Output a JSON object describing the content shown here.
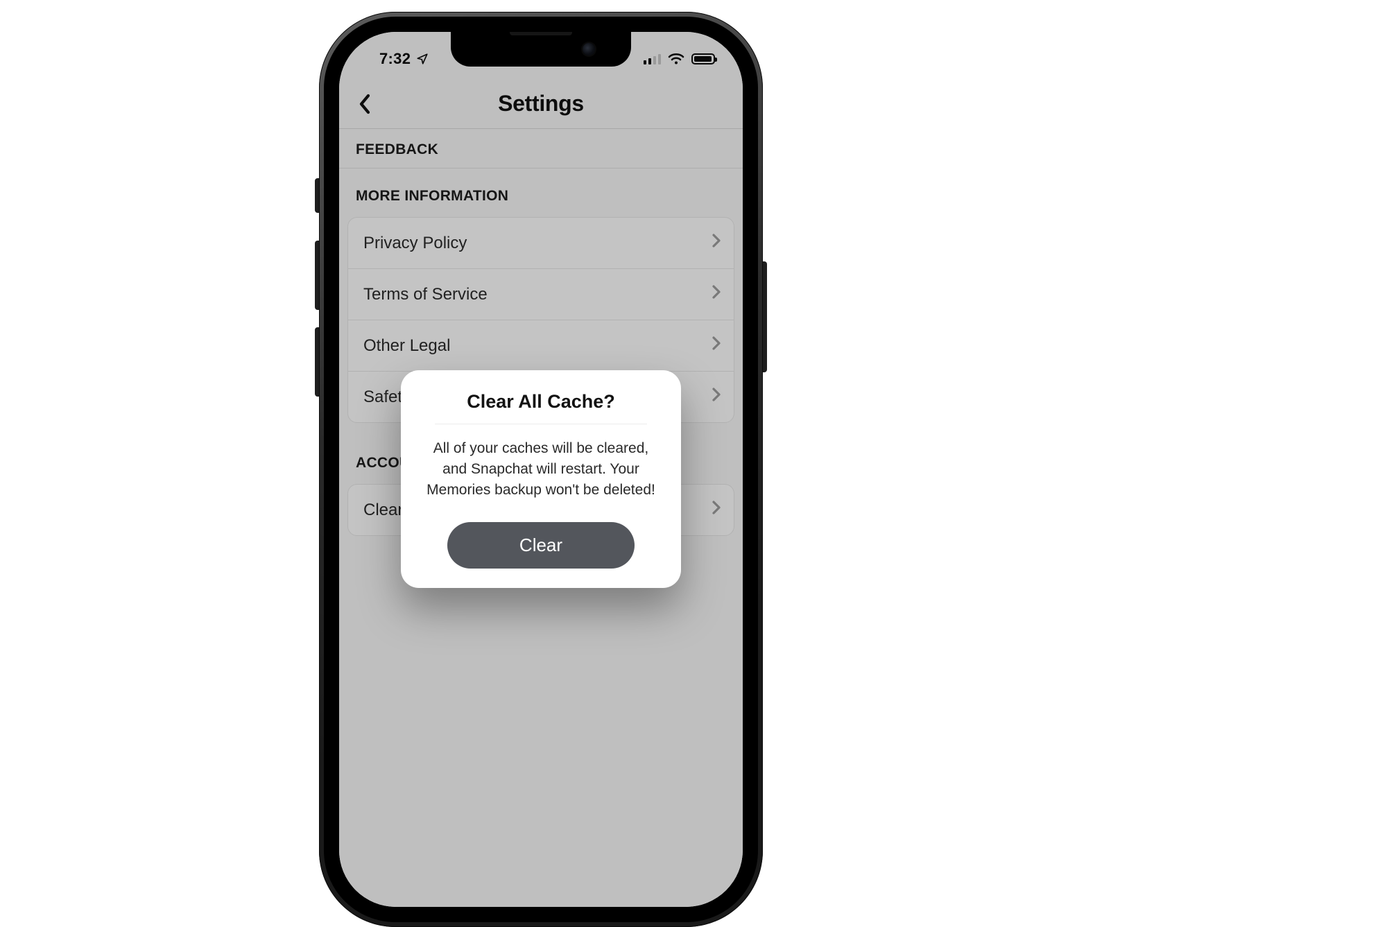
{
  "status": {
    "time": "7:32"
  },
  "nav": {
    "title": "Settings"
  },
  "sections": {
    "feedback_header": "FEEDBACK",
    "more_info_header": "MORE INFORMATION",
    "account_header": "ACCOUNT ACTIONS",
    "more_info": {
      "privacy": "Privacy Policy",
      "terms": "Terms of Service",
      "other_legal": "Other Legal",
      "safety": "Safety Center"
    },
    "account": {
      "clear_cache": "Clear Cache"
    }
  },
  "modal": {
    "title": "Clear All Cache?",
    "body": "All of your caches will be cleared, and Snapchat will restart. Your Memories backup won't be deleted!",
    "confirm": "Clear"
  }
}
